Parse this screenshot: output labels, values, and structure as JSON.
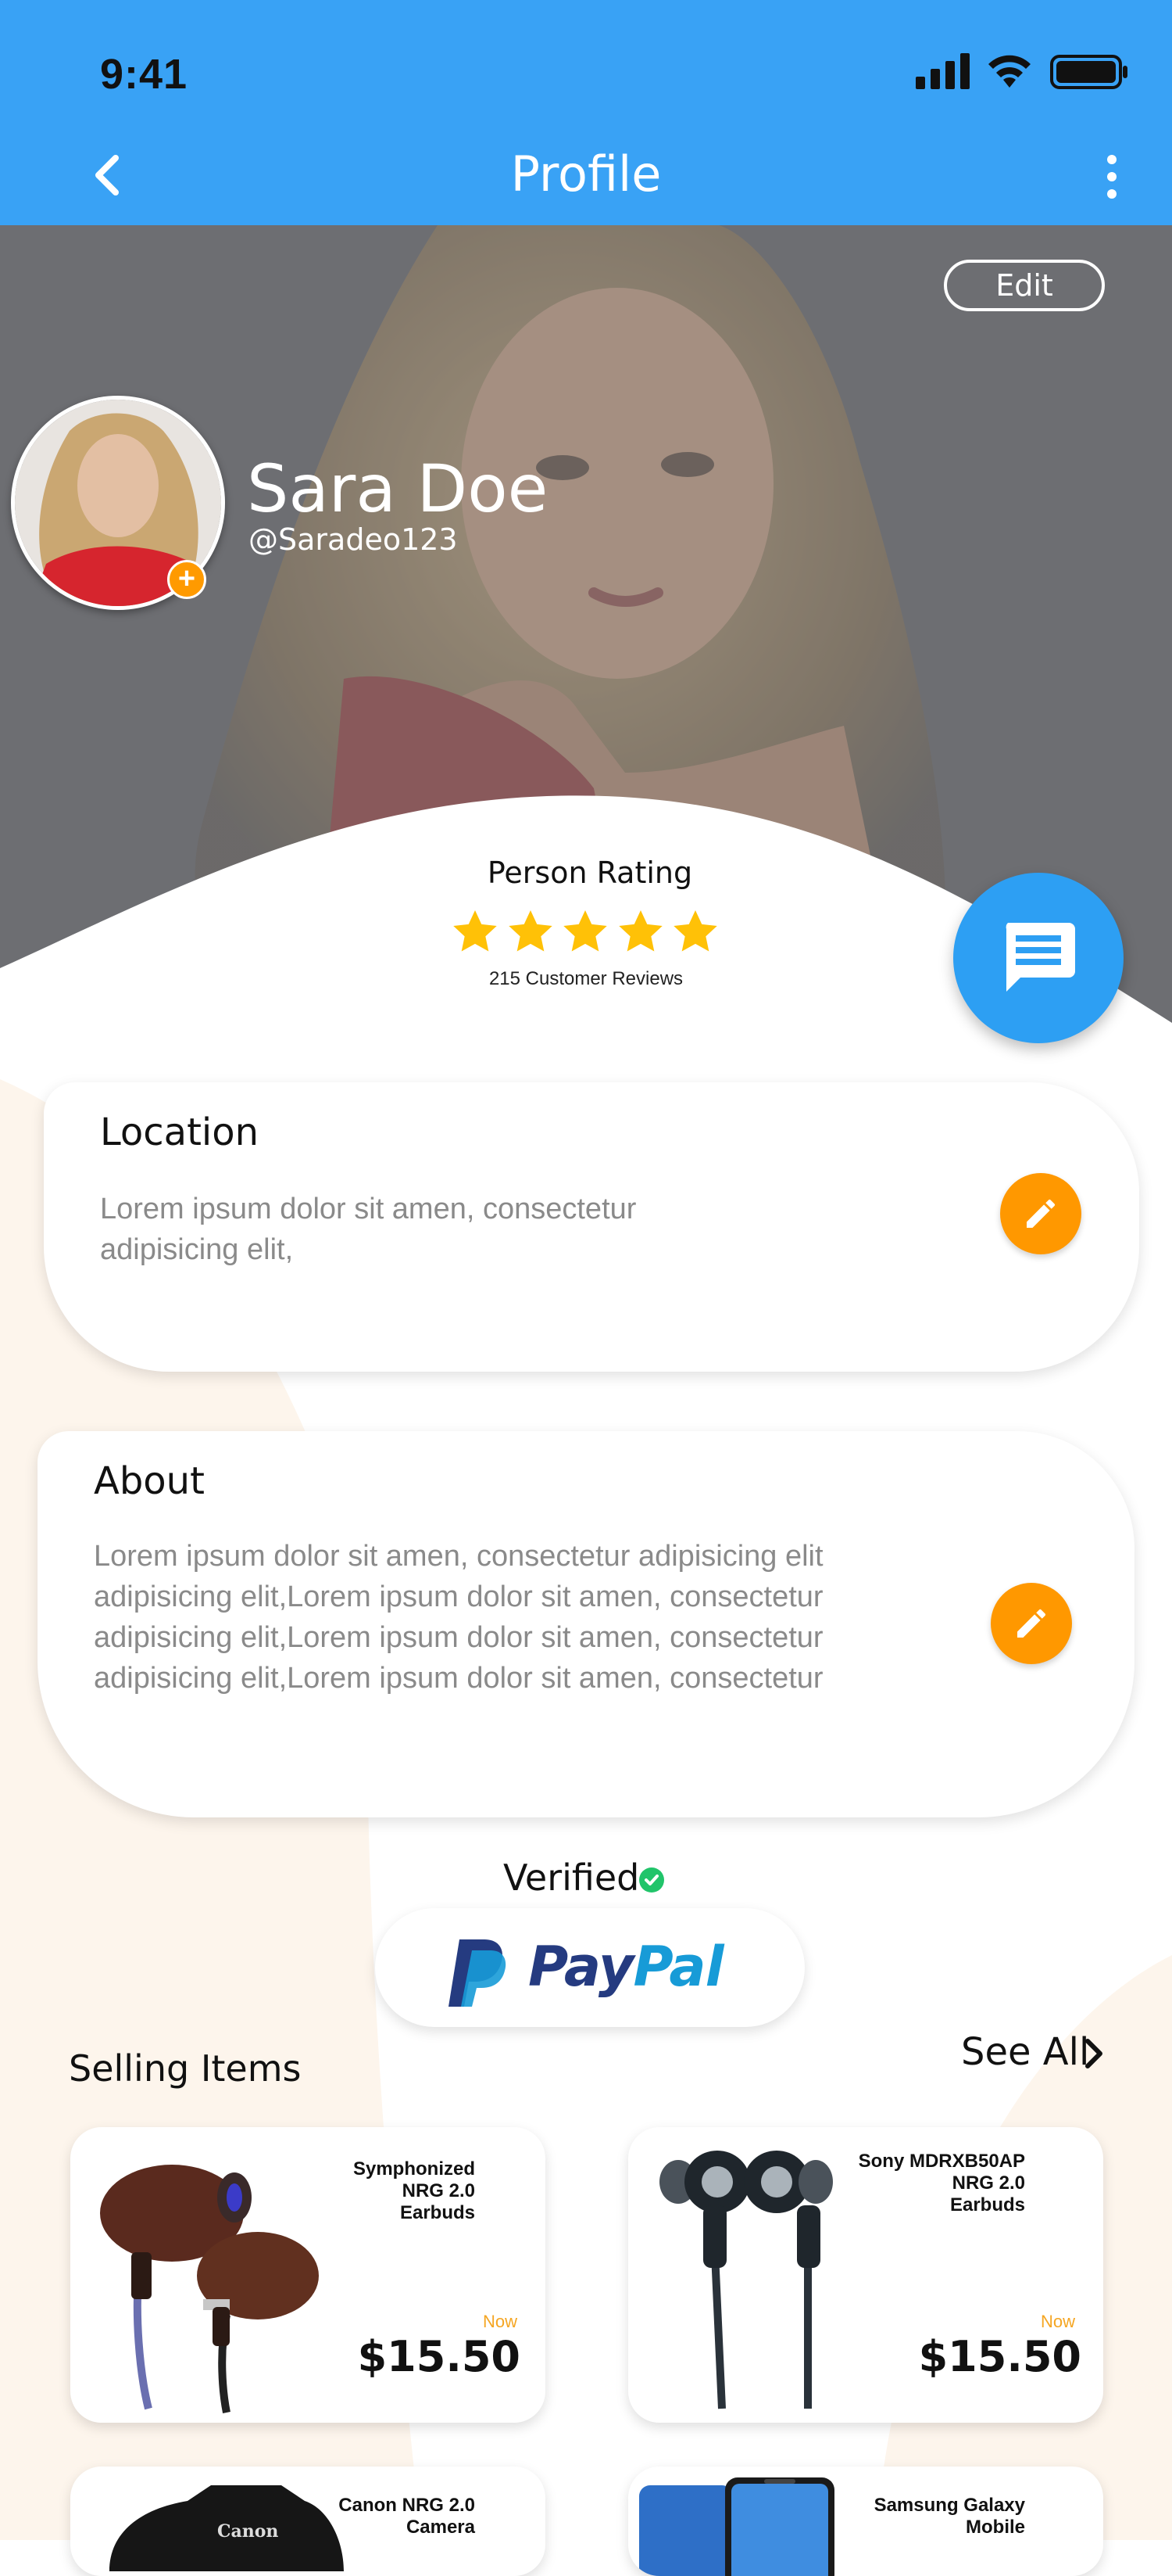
{
  "status_bar": {
    "time": "9:41"
  },
  "header": {
    "title": "Profile"
  },
  "profile": {
    "edit_label": "Edit",
    "name": "Sara Doe",
    "handle": "@Saradeo123",
    "rating_label": "Person Rating",
    "stars": 5,
    "reviews": "215 Customer Reviews"
  },
  "location": {
    "title": "Location",
    "lines": [
      "Lorem ipsum dolor sit amen, consectetur",
      "adipisicing elit,"
    ]
  },
  "about": {
    "title": "About",
    "lines": [
      "Lorem ipsum dolor sit amen, consectetur adipisicing elit",
      "adipisicing elit,Lorem ipsum dolor sit amen, consectetur",
      "adipisicing elit,Lorem ipsum dolor sit amen, consectetur",
      "adipisicing elit,Lorem ipsum dolor sit amen, consectetur"
    ]
  },
  "verified": {
    "label": "Verified",
    "brand": "PayPal"
  },
  "selling": {
    "title": "Selling Items",
    "see_all": "See All",
    "items": [
      {
        "name_lines": [
          "Symphonized",
          "NRG 2.0",
          "Earbuds"
        ],
        "now": "Now",
        "price": "$15.50"
      },
      {
        "name_lines": [
          "Sony MDRXB50AP",
          "NRG 2.0",
          "Earbuds"
        ],
        "now": "Now",
        "price": "$15.50"
      },
      {
        "name_lines": [
          "Canon NRG 2.0",
          "Camera"
        ]
      },
      {
        "name_lines": [
          "Samsung Galaxy",
          "Mobile"
        ]
      }
    ]
  },
  "colors": {
    "primary": "#39a2f5",
    "accent": "#ff9800",
    "verified": "#21c46a",
    "star": "#ffc107"
  }
}
